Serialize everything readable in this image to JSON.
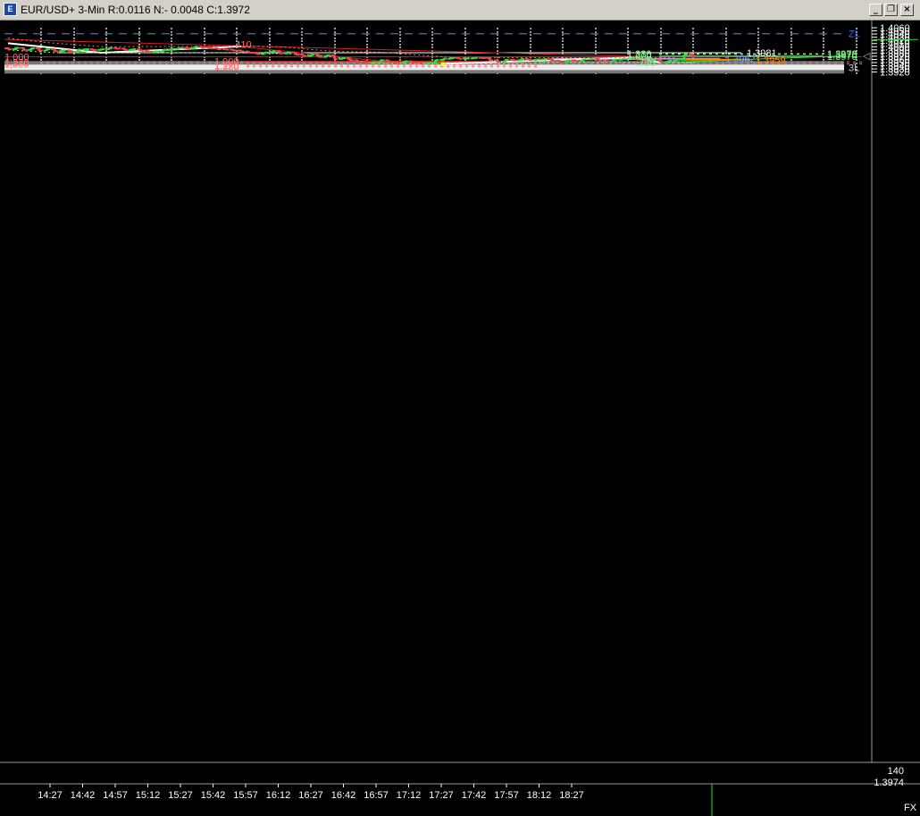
{
  "window": {
    "title": "EUR/USD+ 3-Min R:0.0116 N:- 0.0048 C:1.3972",
    "icon": "chart-window-icon",
    "buttons": [
      "minimize",
      "restore",
      "close"
    ]
  },
  "colors": {
    "background": "#000000",
    "up_bar": "#33dd33",
    "down_bar": "#e84848",
    "axis_text": "#ffffff",
    "zl_line": "#3a6fd8",
    "trendline": "#cc2222",
    "fib_red": "#ff7070",
    "fib_green": "#8ef08e",
    "fib_blue": "#9999ff",
    "fib_orange": "#ff8800"
  },
  "status": {
    "volume": "140",
    "last": "1.3974",
    "market": "FX"
  },
  "chart_data": {
    "type": "candlestick",
    "symbol": "EUR/USD+",
    "interval": "3-Min",
    "y_ticks": [
      "1.4060",
      "1.4050",
      "1.4040",
      "1.4030",
      "1.4020",
      "1.4010",
      "1.4000",
      "1.3990",
      "1.3980",
      "1.3970",
      "1.3960",
      "1.3950",
      "1.3940",
      "1.3930",
      "1.3920"
    ],
    "x_ticks": [
      "14:27",
      "14:42",
      "14:57",
      "15:12",
      "15:27",
      "15:42",
      "15:57",
      "16:12",
      "16:27",
      "16:42",
      "16:57",
      "17:12",
      "17:27",
      "17:42",
      "17:57",
      "18:12",
      "18:27"
    ],
    "ylim": [
      1.3915,
      1.4065
    ],
    "bars": [
      [
        1.3995,
        1.3998,
        1.3991,
        1.3992
      ],
      [
        1.3992,
        1.3999,
        1.3989,
        1.3996
      ],
      [
        1.3996,
        1.3998,
        1.3988,
        1.399
      ],
      [
        1.399,
        1.3997,
        1.3988,
        1.3995
      ],
      [
        1.3995,
        1.3998,
        1.3986,
        1.3988
      ],
      [
        1.3988,
        1.3994,
        1.3987,
        1.3992
      ],
      [
        1.3992,
        1.3993,
        1.3983,
        1.3986
      ],
      [
        1.3986,
        1.3991,
        1.3983,
        1.3988
      ],
      [
        1.3988,
        1.399,
        1.3981,
        1.3984
      ],
      [
        1.3984,
        1.3992,
        1.3983,
        1.3991
      ],
      [
        1.3991,
        1.3995,
        1.3986,
        1.3992
      ],
      [
        1.3992,
        1.3993,
        1.3985,
        1.399
      ],
      [
        1.399,
        1.3994,
        1.3988,
        1.3992
      ],
      [
        1.3992,
        1.3997,
        1.399,
        1.3996
      ],
      [
        1.3996,
        1.3997,
        1.3991,
        1.3994
      ],
      [
        1.3994,
        1.3995,
        1.3989,
        1.399
      ],
      [
        1.399,
        1.3994,
        1.3987,
        1.3992
      ],
      [
        1.3992,
        1.3993,
        1.3986,
        1.3988
      ],
      [
        1.3988,
        1.3989,
        1.3983,
        1.3984
      ],
      [
        1.3984,
        1.3987,
        1.3982,
        1.3985
      ],
      [
        1.3985,
        1.3992,
        1.3984,
        1.399
      ],
      [
        1.399,
        1.3994,
        1.3988,
        1.3993
      ],
      [
        1.3993,
        1.3998,
        1.3992,
        1.3996
      ],
      [
        1.3996,
        1.3999,
        1.3993,
        1.3995
      ],
      [
        1.3995,
        1.4001,
        1.3993,
        1.4
      ],
      [
        1.4,
        1.4001,
        1.3994,
        1.3998
      ],
      [
        1.3998,
        1.4,
        1.3993,
        1.3995
      ],
      [
        1.3995,
        1.3996,
        1.399,
        1.3992
      ],
      [
        1.3992,
        1.3994,
        1.3989,
        1.3991
      ],
      [
        1.3991,
        1.3992,
        1.3986,
        1.3988
      ],
      [
        1.3988,
        1.3989,
        1.3983,
        1.3985
      ],
      [
        1.3985,
        1.3986,
        1.3979,
        1.3981
      ],
      [
        1.3981,
        1.3982,
        1.3976,
        1.3977
      ],
      [
        1.3977,
        1.3983,
        1.3976,
        1.3982
      ],
      [
        1.3982,
        1.3987,
        1.3981,
        1.3986
      ],
      [
        1.3986,
        1.3987,
        1.3977,
        1.3979
      ],
      [
        1.3979,
        1.3984,
        1.3977,
        1.3982
      ],
      [
        1.3982,
        1.3983,
        1.3974,
        1.3975
      ],
      [
        1.3975,
        1.3976,
        1.3969,
        1.3971
      ],
      [
        1.3971,
        1.3976,
        1.3969,
        1.3975
      ],
      [
        1.3975,
        1.3976,
        1.3966,
        1.3968
      ],
      [
        1.3968,
        1.3974,
        1.3967,
        1.3973
      ],
      [
        1.3973,
        1.3974,
        1.3961,
        1.3962
      ],
      [
        1.3962,
        1.3966,
        1.3959,
        1.3964
      ],
      [
        1.3964,
        1.3965,
        1.3956,
        1.3957
      ],
      [
        1.3957,
        1.3958,
        1.3951,
        1.3952
      ],
      [
        1.3952,
        1.3953,
        1.3947,
        1.3949
      ],
      [
        1.3949,
        1.3953,
        1.3948,
        1.3951
      ],
      [
        1.3951,
        1.396,
        1.395,
        1.3957
      ],
      [
        1.3957,
        1.3958,
        1.395,
        1.3951
      ],
      [
        1.3951,
        1.3952,
        1.3947,
        1.3949
      ],
      [
        1.3949,
        1.3955,
        1.3948,
        1.3954
      ],
      [
        1.3954,
        1.3955,
        1.3948,
        1.395
      ],
      [
        1.395,
        1.3951,
        1.3947,
        1.3948
      ],
      [
        1.3948,
        1.395,
        1.3946,
        1.3949
      ],
      [
        1.3949,
        1.3959,
        1.3946,
        1.3958
      ],
      [
        1.3958,
        1.3963,
        1.3955,
        1.3962
      ],
      [
        1.3962,
        1.3966,
        1.396,
        1.3964
      ],
      [
        1.3964,
        1.3965,
        1.3961,
        1.3962
      ],
      [
        1.3962,
        1.3965,
        1.3959,
        1.3963
      ],
      [
        1.3963,
        1.3966,
        1.3961,
        1.3965
      ],
      [
        1.3965,
        1.3966,
        1.3962,
        1.3964
      ],
      [
        1.3964,
        1.3965,
        1.3956,
        1.3957
      ],
      [
        1.3957,
        1.3958,
        1.3951,
        1.3953
      ],
      [
        1.3953,
        1.396,
        1.3952,
        1.3959
      ],
      [
        1.3959,
        1.3961,
        1.3955,
        1.3957
      ],
      [
        1.3957,
        1.3962,
        1.3955,
        1.3961
      ],
      [
        1.3961,
        1.3963,
        1.3957,
        1.3958
      ],
      [
        1.3958,
        1.3962,
        1.3956,
        1.396
      ],
      [
        1.396,
        1.3962,
        1.3957,
        1.3961
      ],
      [
        1.3961,
        1.3962,
        1.3955,
        1.3956
      ],
      [
        1.3956,
        1.3957,
        1.395,
        1.3952
      ],
      [
        1.3952,
        1.3958,
        1.3951,
        1.3957
      ],
      [
        1.3957,
        1.3959,
        1.3952,
        1.3955
      ],
      [
        1.3955,
        1.3962,
        1.3953,
        1.396
      ],
      [
        1.396,
        1.3963,
        1.3958,
        1.3962
      ],
      [
        1.3962,
        1.3963,
        1.3956,
        1.3957
      ],
      [
        1.3957,
        1.3959,
        1.3954,
        1.3955
      ],
      [
        1.3955,
        1.3961,
        1.3954,
        1.3959
      ],
      [
        1.3959,
        1.3962,
        1.3957,
        1.3961
      ],
      [
        1.3961,
        1.3966,
        1.396,
        1.3964
      ],
      [
        1.3964,
        1.3965,
        1.3958,
        1.396
      ],
      [
        1.396,
        1.3961,
        1.3954,
        1.3955
      ],
      [
        1.3955,
        1.396,
        1.3954,
        1.3958
      ],
      [
        1.3958,
        1.3959,
        1.395,
        1.3952
      ],
      [
        1.3952,
        1.3957,
        1.3951,
        1.3956
      ],
      [
        1.3956,
        1.3961,
        1.3955,
        1.3959
      ],
      [
        1.3959,
        1.3976,
        1.3958,
        1.3975
      ],
      [
        1.3975,
        1.3978,
        1.397,
        1.3972
      ]
    ],
    "horizontal_levels": [
      {
        "label": "ZL",
        "value": 1.4041,
        "style": "dashed",
        "color": "#3a6fd8"
      },
      {
        "label": "1.3981",
        "value": 1.3981,
        "color": "#ffffff"
      },
      {
        "label": "1.3962",
        "value": 1.3962,
        "color": "#9999ff"
      },
      {
        "label": "1.3959",
        "value": 1.3959,
        "color": "#ff8800"
      },
      {
        "label": "3L",
        "value": 1.3935,
        "color": "#bbbbbb"
      }
    ],
    "fib_left": [
      {
        "label": "1.000",
        "value": 1.3968
      },
      {
        "label": "1,270",
        "value": 1.3952
      },
      {
        "label": "1,380",
        "value": 1.3946
      }
    ],
    "fib_mid": [
      {
        "label": "1.000",
        "value": 1.3954
      },
      {
        "label": "1.270",
        "value": 1.3942
      },
      {
        "label": "1.380",
        "value": 1.3937
      }
    ],
    "fib_right": [
      {
        "label": "1.380",
        "price": "1.3978",
        "value": 1.3978
      },
      {
        "label": "1.270",
        "price": "1.3976",
        "value": 1.3976
      },
      {
        "label": "1.000",
        "price": "1.3970",
        "value": 1.397
      },
      {
        "label": ".780",
        "value": 1.395
      }
    ],
    "top_marker_label": "410",
    "axis_markers": [
      "1.4000"
    ]
  }
}
